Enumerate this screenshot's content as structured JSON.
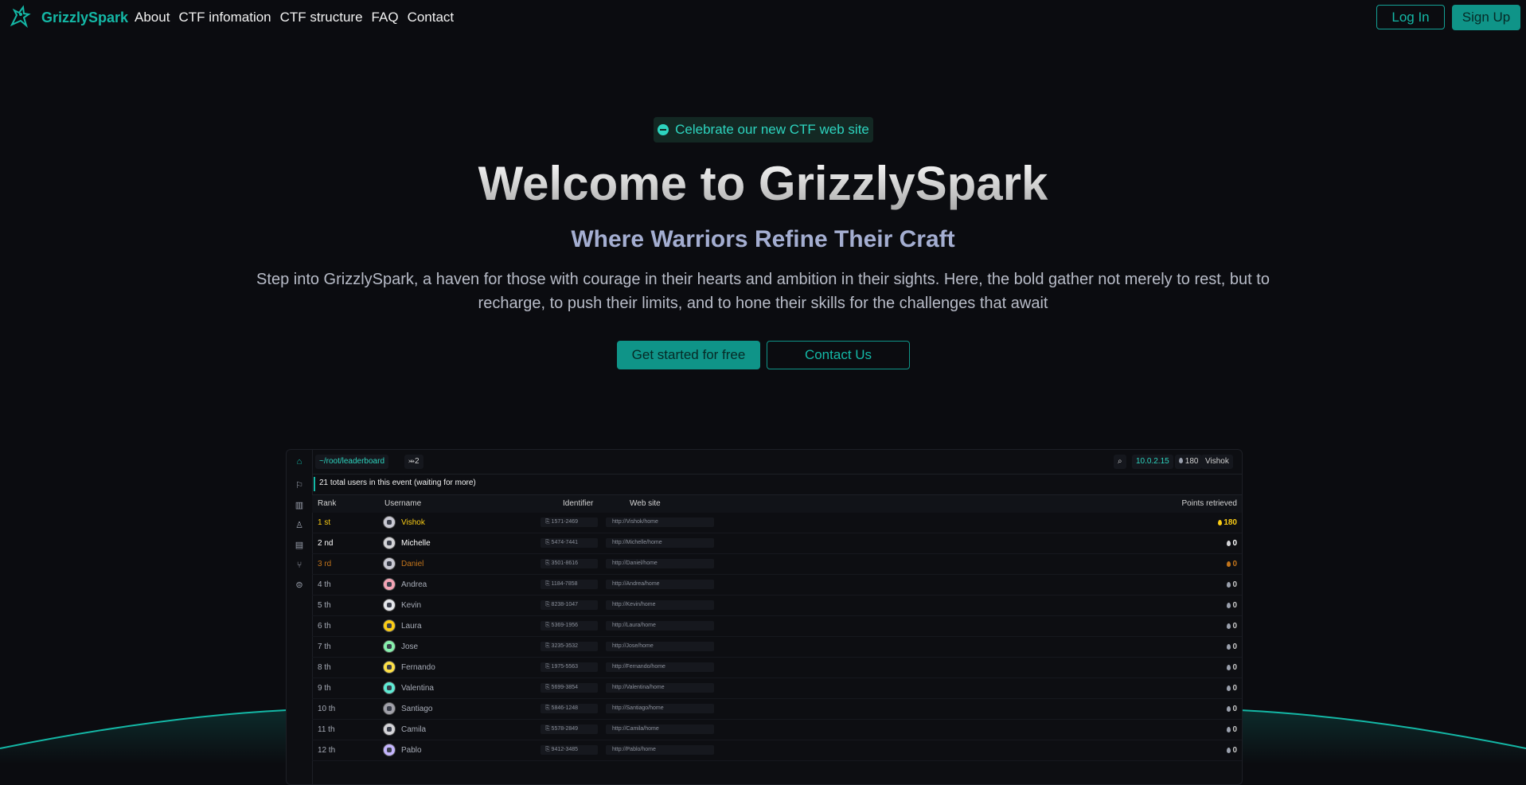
{
  "nav": {
    "brand": "GrizzlySpark",
    "links": [
      "About",
      "CTF infomation",
      "CTF structure",
      "FAQ",
      "Contact"
    ],
    "login": "Log In",
    "signup": "Sign Up"
  },
  "hero": {
    "badge": "Celebrate our new CTF web site",
    "title": "Welcome to GrizzlySpark",
    "subtitle": "Where Warriors Refine Their Craft",
    "description": "Step into GrizzlySpark, a haven for those with courage in their hearts and ambition in their sights. Here, the bold gather not merely to rest, but to recharge, to push their limits, and to hone their skills for the challenges that await",
    "cta_primary": "Get started for free",
    "cta_secondary": "Contact Us"
  },
  "leaderboard": {
    "path": "~/root/leaderboard",
    "tab_count": "⤕2",
    "ip": "10.0.2.15",
    "points": "180",
    "user": "Vishok",
    "info": "21 total users in this event (waiting for more)",
    "columns": [
      "Rank",
      "Username",
      "Identifier",
      "Web site",
      "Points retrieved"
    ],
    "rows": [
      {
        "rank": "1 st",
        "name": "Vishok",
        "id": "1571-2469",
        "site": "http://Vishok/home",
        "points": "180"
      },
      {
        "rank": "2 nd",
        "name": "Michelle",
        "id": "5474-7441",
        "site": "http://Michelle/home",
        "points": "0"
      },
      {
        "rank": "3 rd",
        "name": "Daniel",
        "id": "3501-8616",
        "site": "http://Daniel/home",
        "points": "0"
      },
      {
        "rank": "4 th",
        "name": "Andrea",
        "id": "1184-7858",
        "site": "http://Andrea/home",
        "points": "0"
      },
      {
        "rank": "5 th",
        "name": "Kevin",
        "id": "8238-1047",
        "site": "http://Kevin/home",
        "points": "0"
      },
      {
        "rank": "6 th",
        "name": "Laura",
        "id": "5369-1956",
        "site": "http://Laura/home",
        "points": "0"
      },
      {
        "rank": "7 th",
        "name": "Jose",
        "id": "3235-3532",
        "site": "http://Jose/home",
        "points": "0"
      },
      {
        "rank": "8 th",
        "name": "Fernando",
        "id": "1975-5563",
        "site": "http://Fernando/home",
        "points": "0"
      },
      {
        "rank": "9 th",
        "name": "Valentina",
        "id": "5699-3854",
        "site": "http://Valentina/home",
        "points": "0"
      },
      {
        "rank": "10 th",
        "name": "Santiago",
        "id": "5846-1248",
        "site": "http://Santiago/home",
        "points": "0"
      },
      {
        "rank": "11 th",
        "name": "Camila",
        "id": "5578-2849",
        "site": "http://Camila/home",
        "points": "0"
      },
      {
        "rank": "12 th",
        "name": "Pablo",
        "id": "9412-3485",
        "site": "http://Pablo/home",
        "points": "0"
      }
    ]
  },
  "colors": {
    "accent": "#14b8a6",
    "gold": "#facc15",
    "bronze": "#c2741b",
    "background": "#0b0c10"
  }
}
